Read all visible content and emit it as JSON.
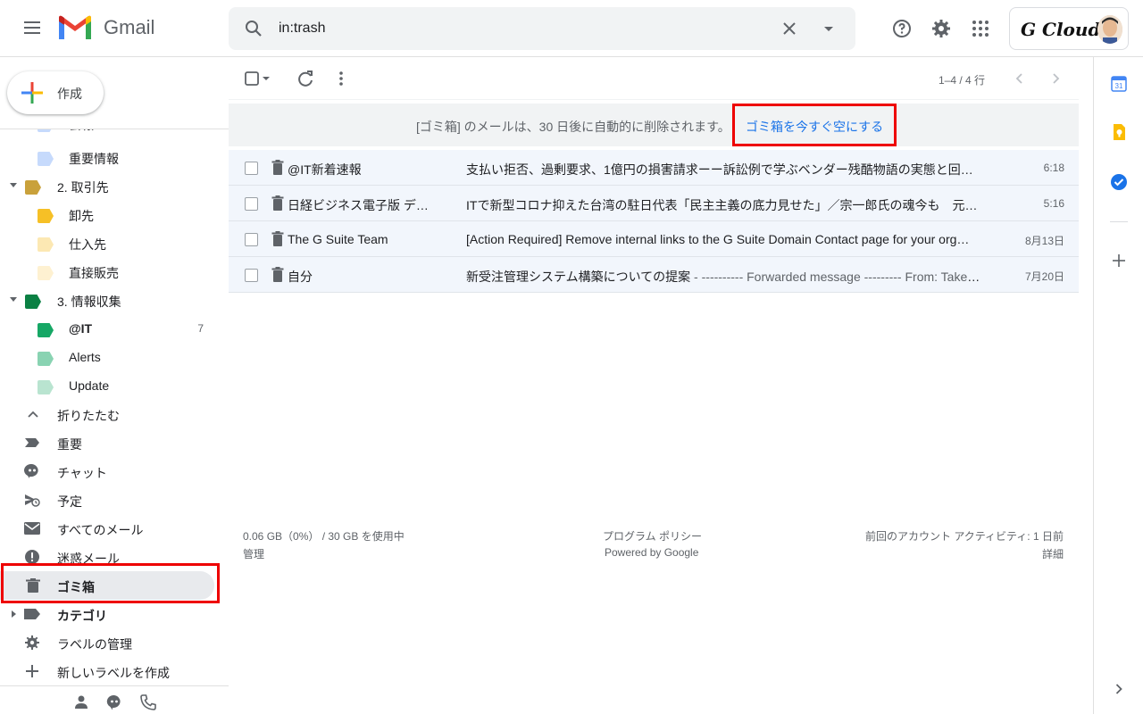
{
  "header": {
    "app_name": "Gmail",
    "search_value": "in:trash",
    "account_name": "G Cloud"
  },
  "sidebar": {
    "compose_label": "作成",
    "partial_item_label": "会報",
    "items": [
      {
        "label": "重要情報",
        "color": "#c6dafc"
      },
      {
        "label": "2. 取引先",
        "color": "#c9a13b"
      },
      {
        "label": "卸先",
        "color": "#f6c026"
      },
      {
        "label": "仕入先",
        "color": "#fce8b3"
      },
      {
        "label": "直接販売",
        "color": "#fef1d1"
      },
      {
        "label": "3. 情報収集",
        "color": "#0b8043"
      },
      {
        "label": "@IT",
        "count": "7",
        "color": "#16a765"
      },
      {
        "label": "Alerts",
        "color": "#89d3b2"
      },
      {
        "label": "Update",
        "color": "#b9e4d0"
      },
      {
        "label": "折りたたむ"
      },
      {
        "label": "重要"
      },
      {
        "label": "チャット"
      },
      {
        "label": "予定"
      },
      {
        "label": "すべてのメール"
      },
      {
        "label": "迷惑メール"
      },
      {
        "label": "ゴミ箱"
      },
      {
        "label": "カテゴリ"
      },
      {
        "label": "ラベルの管理"
      },
      {
        "label": "新しいラベルを作成"
      }
    ]
  },
  "toolbar": {
    "pager": "1–4 / 4 行"
  },
  "banner": {
    "text": "[ゴミ箱] のメールは、30 日後に自動的に削除されます。",
    "action": "ゴミ箱を今すぐ空にする"
  },
  "emails": [
    {
      "sender": "@IT新着速報",
      "subject": "支払い拒否、過剰要求、1億円の損害請求ーー訴訟例で学ぶベンダー残酷物語の実態と回…",
      "snippet": "",
      "date": "6:18"
    },
    {
      "sender": "日経ビジネス電子版 デ…",
      "subject": "ITで新型コロナ抑えた台湾の駐日代表「民主主義の底力見せた」／宗一郎氏の魂今も　元…",
      "snippet": "",
      "date": "5:16"
    },
    {
      "sender": "The G Suite Team",
      "subject": "[Action Required] Remove internal links to the G Suite Domain Contact page for your org…",
      "snippet": "",
      "date": "8月13日"
    },
    {
      "sender": "自分",
      "subject": "新受注管理システム構築についての提案",
      "snippet": " - ---------- Forwarded message --------- From: Takehi…",
      "date": "7月20日"
    }
  ],
  "footer": {
    "storage": "0.06 GB（0%） / 30 GB を使用中",
    "manage": "管理",
    "policy": "プログラム ポリシー",
    "powered": "Powered by Google",
    "activity": "前回のアカウント アクティビティ: 1 日前",
    "details": "詳細"
  },
  "side_panel": {
    "calendar_day": "31"
  },
  "colors": {
    "accent_blue": "#1a73e8",
    "highlight_red": "#ee0000",
    "row_bg": "#f2f6fc"
  }
}
